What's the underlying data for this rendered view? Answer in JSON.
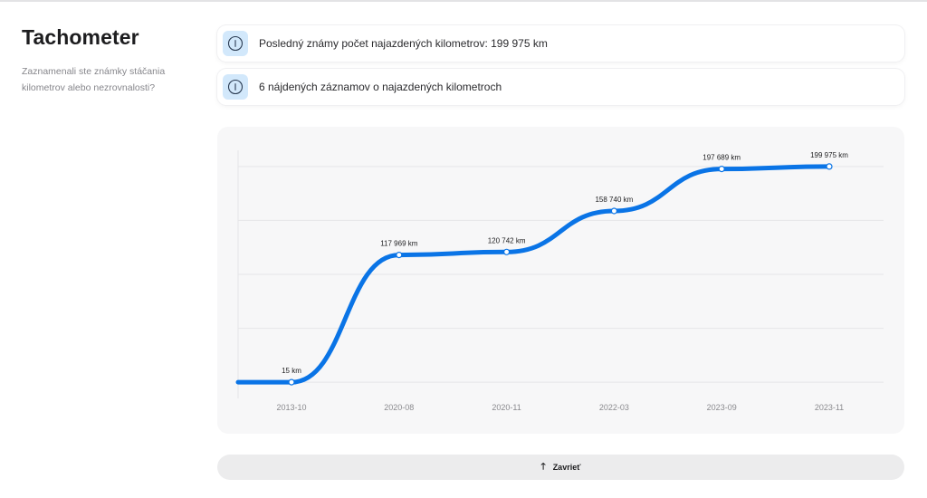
{
  "header": {
    "title": "Tachometer",
    "subtitle": "Zaznamenali ste známky stáčania kilometrov alebo nezrovnalosti?"
  },
  "info_cards": [
    {
      "icon": "info-icon",
      "text": "Posledný známy počet najazdených kilometrov: 199 975 km"
    },
    {
      "icon": "info-icon",
      "text": "6 nájdených záznamov o najazdených kilometroch"
    }
  ],
  "close_button": {
    "icon": "arrow-up-icon",
    "label": "Zavrieť"
  },
  "colors": {
    "line": "#0a74e6",
    "icon_bg": "#d2e8fb",
    "panel_bg": "#f7f7f8"
  },
  "chart_data": {
    "type": "line",
    "categories": [
      "2013-10",
      "2020-08",
      "2020-11",
      "2022-03",
      "2023-09",
      "2023-11"
    ],
    "values": [
      15,
      117969,
      120742,
      158740,
      197689,
      199975
    ],
    "data_labels": [
      "15 km",
      "117 969 km",
      "120 742 km",
      "158 740 km",
      "197 689 km",
      "199 975 km"
    ],
    "ylim": [
      -15000,
      215000
    ],
    "grid": "horizontal",
    "title": "",
    "xlabel": "",
    "ylabel": ""
  }
}
